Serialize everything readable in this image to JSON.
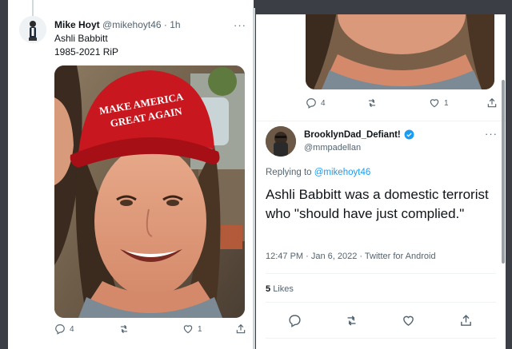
{
  "left_tweet": {
    "author_name": "Mike Hoyt",
    "author_handle": "@mikehoyt46",
    "time": "· 1h",
    "more": "···",
    "text_line1": "Ashli Babbitt",
    "text_line2": "1985-2021 RiP",
    "hat_text_line1": "MAKE AMERICA",
    "hat_text_line2": "GREAT AGAIN",
    "reply_count": "4",
    "retweet_count": "",
    "like_count": "1"
  },
  "right_top_actions": {
    "reply_count": "4",
    "like_count": "1"
  },
  "right_tweet": {
    "author_name": "BrooklynDad_Defiant!",
    "author_handle": "@mmpadellan",
    "more": "···",
    "replying_prefix": "Replying to",
    "replying_handle": "@mikehoyt46",
    "text": "Ashli Babbitt was a domestic terrorist who \"should have just complied.\"",
    "meta": "12:47 PM · Jan 6, 2022 · Twitter for Android",
    "likes_count": "5",
    "likes_label": "Likes"
  },
  "colors": {
    "accent": "#1d9bf0",
    "hat_red": "#c8171e",
    "text_secondary": "#536471"
  },
  "icons": [
    "reply-icon",
    "retweet-icon",
    "like-icon",
    "share-icon",
    "verified-badge-icon"
  ]
}
